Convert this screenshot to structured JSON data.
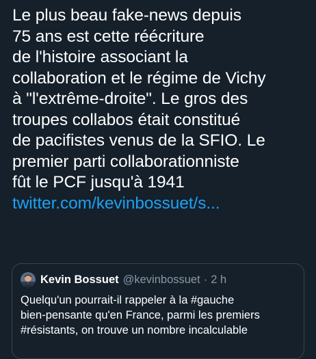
{
  "tweet": {
    "lines": [
      "Le plus beau fake-news depuis",
      "75 ans est cette réécriture",
      "de l'histoire associant la",
      "collaboration et le régime de Vichy",
      "à \"l'extrême-droite\".  Le gros des",
      "troupes collabos était constitué",
      "de pacifistes venus de la SFIO. Le",
      "premier parti collaborationniste",
      "fût le PCF jusqu'à 1941"
    ],
    "link": "twitter.com/kevinbossuet/s..."
  },
  "quote": {
    "avatar_icon": "user-avatar",
    "name": "Kevin Bossuet",
    "handle": "@kevinbossuet",
    "separator": "·",
    "time": "2 h",
    "lines": [
      "Quelqu'un pourrait-il rappeler à la #gauche",
      "bien-pensante qu'en France, parmi les premiers",
      "#résistants, on trouve un nombre incalculable"
    ]
  },
  "colors": {
    "background": "#15202b",
    "text": "#ffffff",
    "link": "#1da1f2",
    "secondary": "#8899a6",
    "border": "#38444d"
  }
}
